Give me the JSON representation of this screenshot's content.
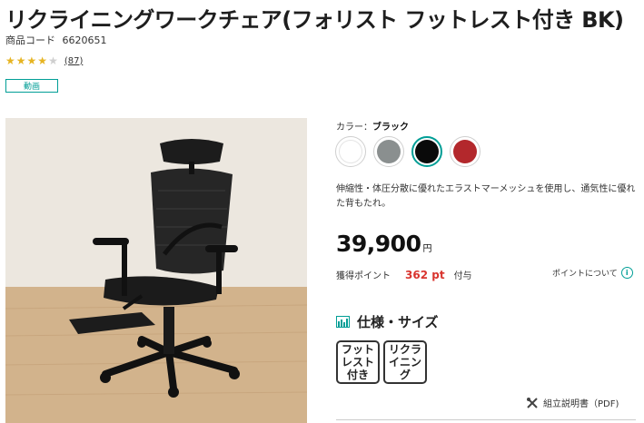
{
  "product": {
    "title": "リクライニングワークチェア(フォリスト フットレスト付き BK)",
    "code_label": "商品コード",
    "code_value": "6620651",
    "rating": {
      "value": 4,
      "max": 5,
      "count_text": "(87)"
    },
    "video_badge": "動画"
  },
  "colors": {
    "label": "カラー：",
    "selected": "ブラック",
    "swatches": [
      "#ffffff",
      "#8a8f8f",
      "#0a0a0a",
      "#b3282c"
    ],
    "accent": "#009e96"
  },
  "description": "伸縮性・体圧分散に優れたエラストマーメッシュを使用し、通気性に優れた背もたれ。",
  "price": {
    "value": "39,900",
    "unit": "円"
  },
  "points": {
    "label": "獲得ポイント",
    "value": "362 pt",
    "suffix": "付与",
    "about": "ポイントについて",
    "color": "#d9352f"
  },
  "spec": {
    "title": "仕様・サイズ",
    "tags": [
      "フットレスト付き",
      "リクライニング"
    ]
  },
  "manual_link": "組立説明書（PDF)"
}
